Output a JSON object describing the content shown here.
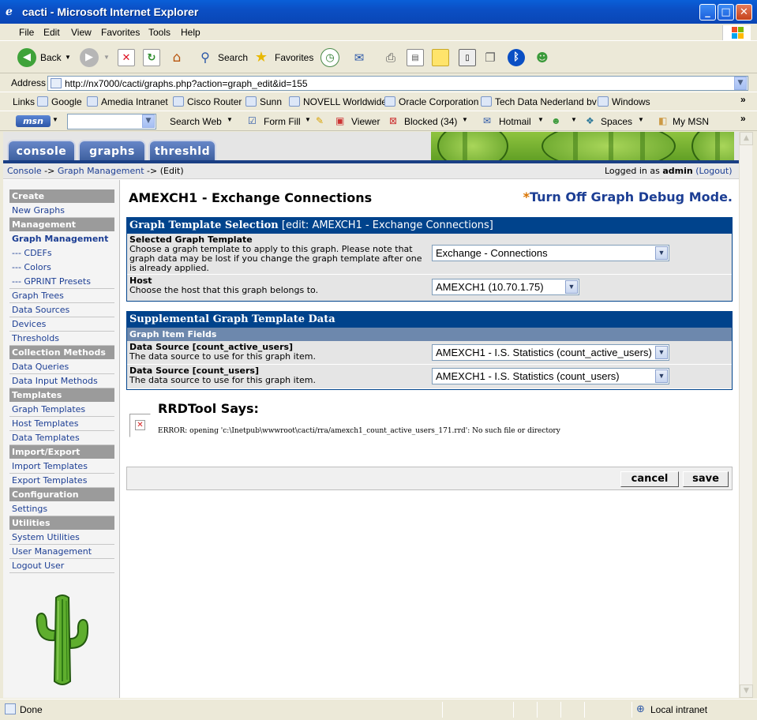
{
  "window": {
    "title": "cacti - Microsoft Internet Explorer",
    "minimize": "_",
    "maximize": "□",
    "close": "✕"
  },
  "menubar": [
    "File",
    "Edit",
    "View",
    "Favorites",
    "Tools",
    "Help"
  ],
  "toolbar": {
    "back": "Back",
    "search": "Search",
    "favorites": "Favorites"
  },
  "address": {
    "label": "Address",
    "url": "http://nx7000/cacti/graphs.php?action=graph_edit&id=155"
  },
  "links": {
    "label": "Links",
    "items": [
      "Google",
      "Amedia Intranet",
      "Cisco Router",
      "Sunn",
      "NOVELL Worldwide",
      "Oracle Corporation",
      "Tech Data Nederland bv",
      "Windows"
    ]
  },
  "msnbar": {
    "logo": "msn",
    "search_web": "Search Web",
    "form_fill": "Form Fill",
    "viewer": "Viewer",
    "blocked": "Blocked (34)",
    "hotmail": "Hotmail",
    "spaces": "Spaces",
    "my_msn": "My MSN"
  },
  "cacti": {
    "tabs": [
      "console",
      "graphs",
      "threshld"
    ],
    "breadcrumb": {
      "console": "Console",
      "sep": " -> ",
      "graph_mgmt": "Graph Management",
      "edit": "(Edit)"
    },
    "login": {
      "prefix": "Logged in as ",
      "user": "admin",
      "logout": "(Logout)"
    },
    "menu": {
      "create": "Create",
      "new_graphs": "New Graphs",
      "management": "Management",
      "graph_management": "Graph Management",
      "cdefs": "--- CDEFs",
      "colors": "--- Colors",
      "gprint": "--- GPRINT Presets",
      "graph_trees": "Graph Trees",
      "data_sources": "Data Sources",
      "devices": "Devices",
      "thresholds": "Thresholds",
      "collection_methods": "Collection Methods",
      "data_queries": "Data Queries",
      "data_input_methods": "Data Input Methods",
      "templates": "Templates",
      "graph_templates": "Graph Templates",
      "host_templates": "Host Templates",
      "data_templates": "Data Templates",
      "import_export": "Import/Export",
      "import_templates": "Import Templates",
      "export_templates": "Export Templates",
      "configuration": "Configuration",
      "settings": "Settings",
      "utilities": "Utilities",
      "system_utilities": "System Utilities",
      "user_management": "User Management",
      "logout_user": "Logout User"
    },
    "page_title": "AMEXCH1 - Exchange Connections",
    "debug_asterisk": "*",
    "debug_link": "Turn Off Graph Debug Mode.",
    "template_box": {
      "header_bold": "Graph Template Selection",
      "header_rest": " [edit: AMEXCH1 - Exchange Connections]",
      "selected_label": "Selected Graph Template",
      "selected_desc": "Choose a graph template to apply to this graph. Please note that graph data may be lost if you change the graph template after one is already applied.",
      "selected_value": "Exchange - Connections",
      "host_label": "Host",
      "host_desc": "Choose the host that this graph belongs to.",
      "host_value": "AMEXCH1 (10.70.1.75)"
    },
    "supplemental_box": {
      "header": "Supplemental Graph Template Data",
      "subheader": "Graph Item Fields",
      "ds1_label": "Data Source [count_active_users]",
      "ds1_desc": "The data source to use for this graph item.",
      "ds1_value": "AMEXCH1 - I.S. Statistics (count_active_users)",
      "ds2_label": "Data Source [count_users]",
      "ds2_desc": "The data source to use for this graph item.",
      "ds2_value": "AMEXCH1 - I.S. Statistics (count_users)"
    },
    "rrdtool": {
      "title": "RRDTool Says:",
      "error": "ERROR: opening 'c:\\Inetpub\\wwwroot\\cacti/rra/amexch1_count_active_users_171.rrd': No such file or directory"
    },
    "buttons": {
      "cancel": "cancel",
      "save": "save"
    }
  },
  "status": {
    "text": "Done",
    "zone": "Local intranet"
  }
}
